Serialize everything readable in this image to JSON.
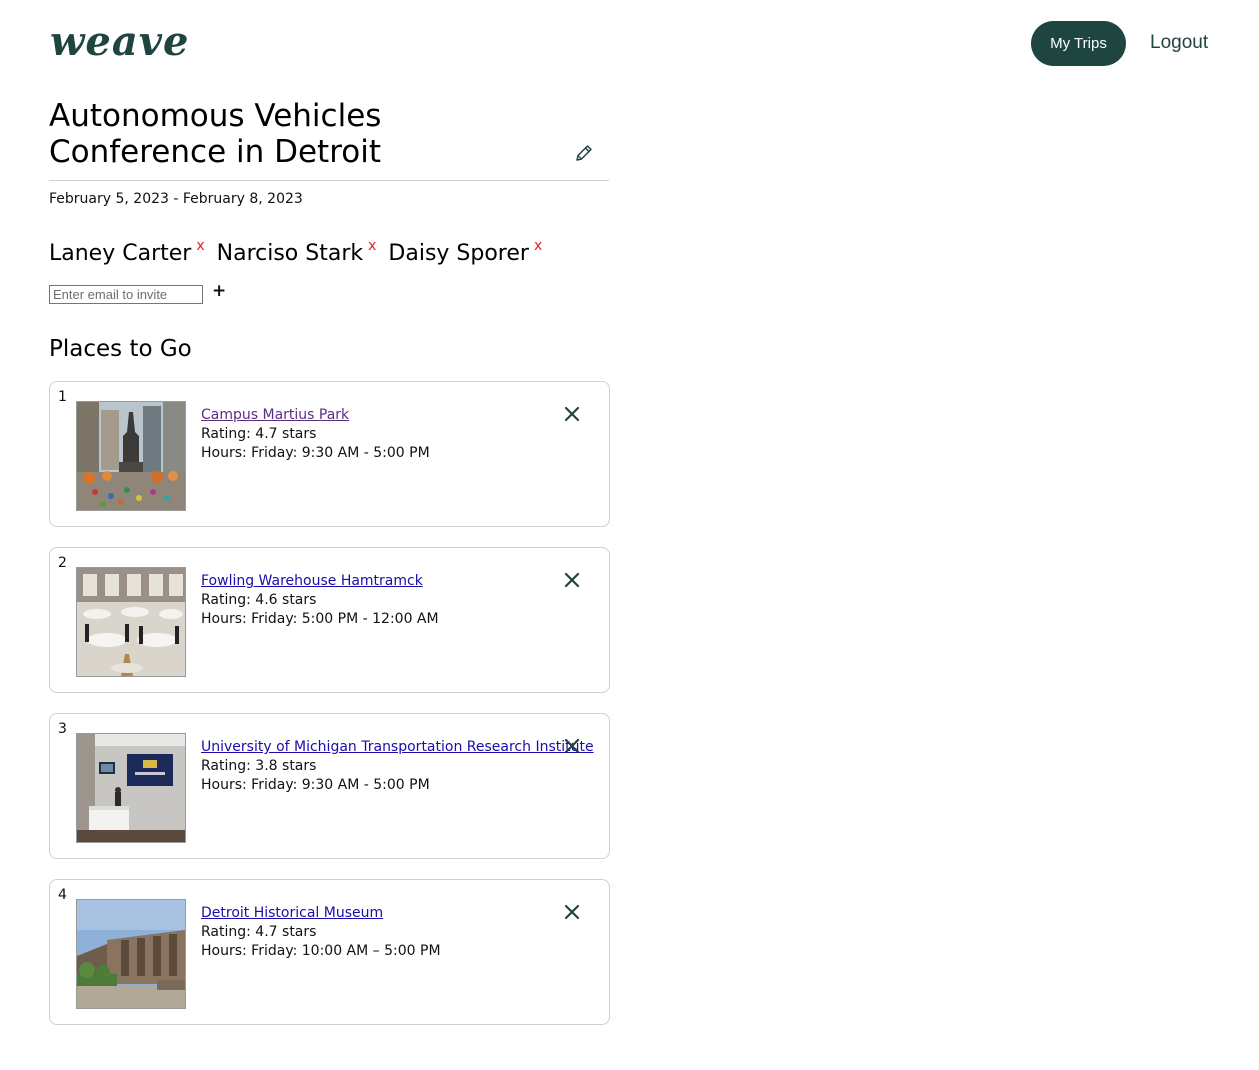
{
  "header": {
    "logo": "weave",
    "my_trips_label": "My Trips",
    "logout_label": "Logout"
  },
  "trip": {
    "title": "Autonomous Vehicles Conference in Detroit",
    "dates": "February 5, 2023 - February 8, 2023"
  },
  "members": [
    {
      "name": "Laney Carter",
      "remove_label": "x"
    },
    {
      "name": "Narciso Stark",
      "remove_label": "x"
    },
    {
      "name": "Daisy Sporer",
      "remove_label": "x"
    }
  ],
  "invite": {
    "placeholder": "Enter email to invite",
    "add_label": "+"
  },
  "places_section": {
    "title": "Places to Go",
    "places": [
      {
        "index": "1",
        "name": "Campus Martius Park",
        "rating": "Rating: 4.7 stars",
        "hours": "Hours: Friday: 9:30 AM - 5:00 PM"
      },
      {
        "index": "2",
        "name": "Fowling Warehouse Hamtramck",
        "rating": "Rating: 4.6 stars",
        "hours": "Hours: Friday: 5:00 PM - 12:00 AM"
      },
      {
        "index": "3",
        "name": "University of Michigan Transportation Research Institute",
        "rating": "Rating: 3.8 stars",
        "hours": "Hours: Friday: 9:30 AM - 5:00 PM"
      },
      {
        "index": "4",
        "name": "Detroit Historical Museum",
        "rating": "Rating: 4.7 stars",
        "hours": "Hours: Friday: 10:00 AM – 5:00 PM"
      }
    ]
  },
  "colors": {
    "brand": "#1f4541",
    "link": "#1a0dab",
    "visited_link": "#5a2d82",
    "remove_member": "#e02020",
    "border": "#cfcfcf"
  },
  "icons": {
    "edit": "pencil-icon",
    "remove_place": "close-icon",
    "add_invite": "plus-icon"
  }
}
